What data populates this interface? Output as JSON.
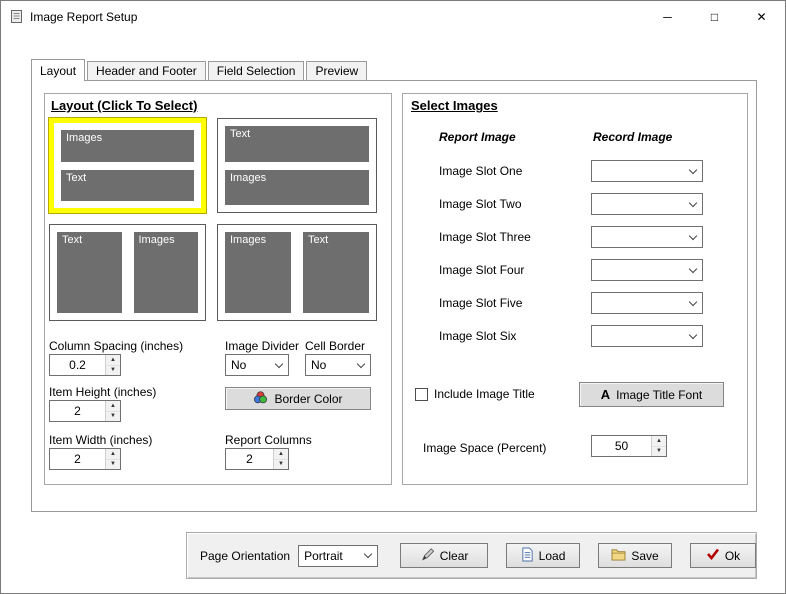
{
  "window": {
    "title": "Image Report Setup"
  },
  "icons": {
    "minimize": "─",
    "maximize": "□",
    "close": "✕",
    "spin_up": "▲",
    "spin_down": "▼",
    "font_letter": "A"
  },
  "tabs": [
    {
      "label": "Layout",
      "active": true
    },
    {
      "label": "Header and Footer",
      "active": false
    },
    {
      "label": "Field Selection",
      "active": false
    },
    {
      "label": "Preview",
      "active": false
    }
  ],
  "layout": {
    "title": "Layout (Click To Select)",
    "options": [
      {
        "id": "images-over-text",
        "selected": true,
        "arrangement": "stacked",
        "blocks": [
          "Images",
          "Text"
        ]
      },
      {
        "id": "text-over-images",
        "selected": false,
        "arrangement": "stacked",
        "blocks": [
          "Text",
          "Images"
        ]
      },
      {
        "id": "text-beside-images",
        "selected": false,
        "arrangement": "side-by-side",
        "blocks": [
          "Text",
          "Images"
        ]
      },
      {
        "id": "images-beside-text",
        "selected": false,
        "arrangement": "side-by-side",
        "blocks": [
          "Images",
          "Text"
        ]
      }
    ],
    "column_spacing": {
      "label": "Column Spacing (inches)",
      "value": "0.2"
    },
    "image_divider": {
      "label": "Image Divider",
      "value": "No"
    },
    "cell_border": {
      "label": "Cell Border",
      "value": "No"
    },
    "border_color_label": "Border Color",
    "item_height": {
      "label": "Item Height (inches)",
      "value": "2"
    },
    "item_width": {
      "label": "Item Width (inches)",
      "value": "2"
    },
    "report_columns": {
      "label": "Report Columns",
      "value": "2"
    }
  },
  "select_images": {
    "title": "Select Images",
    "report_image_header": "Report Image",
    "record_image_header": "Record Image",
    "slots": [
      {
        "label": "Image Slot One",
        "value": ""
      },
      {
        "label": "Image Slot Two",
        "value": ""
      },
      {
        "label": "Image Slot Three",
        "value": ""
      },
      {
        "label": "Image Slot Four",
        "value": ""
      },
      {
        "label": "Image Slot Five",
        "value": ""
      },
      {
        "label": "Image Slot Six",
        "value": ""
      }
    ],
    "include_image_title": {
      "label": "Include Image Title",
      "checked": false
    },
    "image_title_font_label": "Image Title Font",
    "image_space": {
      "label": "Image Space (Percent)",
      "value": "50"
    }
  },
  "footer": {
    "page_orientation": {
      "label": "Page Orientation",
      "value": "Portrait"
    },
    "clear_label": "Clear",
    "load_label": "Load",
    "save_label": "Save",
    "ok_label": "Ok"
  },
  "colors": {
    "selected_layout_border": "#ffff00",
    "layout_block_fill": "#6e6e6e",
    "ok_check": "#b30000"
  }
}
